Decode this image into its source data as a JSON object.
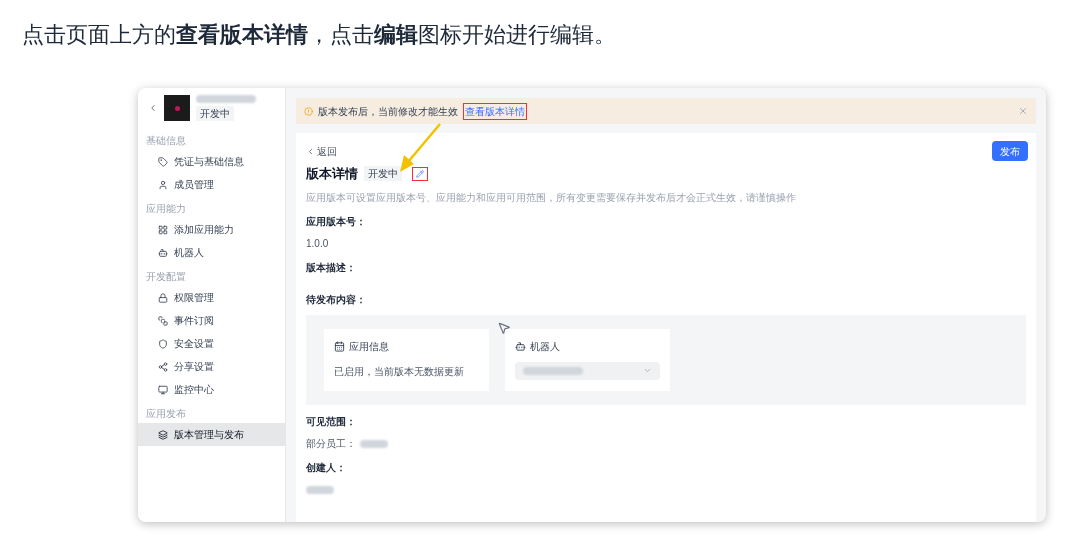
{
  "instruction": "点击页面上方的**查看版本详情**，点击**编辑**图标开始进行编辑。",
  "app": {
    "status": "开发中"
  },
  "sidebar": {
    "sections": [
      {
        "title": "基础信息",
        "items": [
          {
            "label": "凭证与基础信息",
            "selected": false
          },
          {
            "label": "成员管理",
            "selected": false
          }
        ]
      },
      {
        "title": "应用能力",
        "items": [
          {
            "label": "添加应用能力",
            "selected": false
          },
          {
            "label": "机器人",
            "selected": false
          }
        ]
      },
      {
        "title": "开发配置",
        "items": [
          {
            "label": "权限管理",
            "selected": false
          },
          {
            "label": "事件订阅",
            "selected": false
          },
          {
            "label": "安全设置",
            "selected": false
          },
          {
            "label": "分享设置",
            "selected": false
          },
          {
            "label": "监控中心",
            "selected": false
          }
        ]
      },
      {
        "title": "应用发布",
        "items": [
          {
            "label": "版本管理与发布",
            "selected": true
          }
        ]
      }
    ]
  },
  "banner": {
    "text": "版本发布后，当前修改才能生效",
    "link": "查看版本详情"
  },
  "back": "返回",
  "page": {
    "title": "版本详情",
    "status": "开发中",
    "description": "应用版本可设置应用版本号、应用能力和应用可用范围，所有变更需要保存并发布后才会正式生效，请谨慎操作"
  },
  "publish_button": "发布",
  "fields": [
    {
      "kind": "text",
      "label": "应用版本号：",
      "value": "1.0.0"
    },
    {
      "kind": "text",
      "label": "版本描述："
    },
    {
      "kind": "cards",
      "label": "待发布内容：",
      "cards": [
        {
          "kind": "info",
          "title": "应用信息",
          "text": "已启用，当前版本无数据更新"
        },
        {
          "kind": "select",
          "title": "机器人"
        }
      ]
    },
    {
      "kind": "text",
      "label": "可见范围：",
      "value": "部分员工：",
      "redacted": true
    },
    {
      "kind": "text",
      "label": "创建人：",
      "redacted": true
    }
  ]
}
